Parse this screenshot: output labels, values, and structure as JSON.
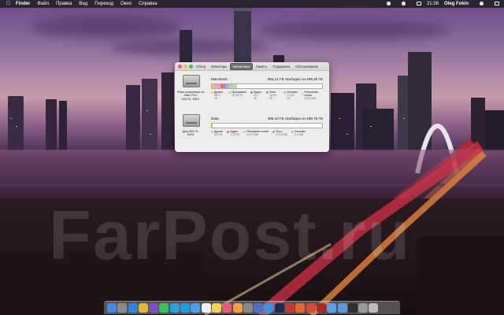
{
  "menubar": {
    "items": [
      "Finder",
      "Файл",
      "Правка",
      "Вид",
      "Переход",
      "Окно",
      "Справка"
    ],
    "clock": "21:38",
    "user": "Oleg Fokin"
  },
  "watermark": "FarPost.ru",
  "about_window": {
    "tabs": [
      "Обзор",
      "Мониторы",
      "Хранилище",
      "Память",
      "Поддержка",
      "Обслуживание"
    ],
    "active_tab": "Хранилище",
    "disks": [
      {
        "name": "Macintosh",
        "free": "384,21 ГБ свободно из 499,25 ГБ",
        "caption": [
          "Флэш-хранилище на",
          "базе PCIe",
          "500 ГБ, SATA"
        ],
        "segments": [
          {
            "color": "#f2c84b",
            "percent": 3
          },
          {
            "color": "#f0a6c4",
            "percent": 5
          },
          {
            "color": "#e46a7a",
            "percent": 3
          },
          {
            "color": "#c879d6",
            "percent": 2
          },
          {
            "color": "#7bc6e8",
            "percent": 2
          },
          {
            "color": "#b4d6a0",
            "percent": 8
          }
        ],
        "legend": [
          {
            "label": "Другие",
            "value": "68,71 ГБ",
            "color": "#f2c84b"
          },
          {
            "label": "Программы",
            "value": "22,39 ГБ",
            "color": "#f0a6c4"
          },
          {
            "label": "Аудио",
            "value": "22,7 ГБ",
            "color": "#e46a7a"
          },
          {
            "label": "Фото",
            "value": "18,09 ГБ",
            "color": "#c879d6"
          },
          {
            "label": "Фильмы",
            "value": "17,29 ГБ",
            "color": "#7bc6e8"
          },
          {
            "label": "Резервные копии",
            "value": "479,8 МБ",
            "color": "#b4d6a0"
          }
        ]
      },
      {
        "name": "Data",
        "free": "498,10 ГБ свободно из 499,78 ГБ",
        "caption": [
          "Диск 500 ГБ,",
          "SATA"
        ],
        "segments": [
          {
            "color": "#f2c84b",
            "percent": 1
          }
        ],
        "legend": [
          {
            "label": "Другие",
            "value": "4,6 ГБ",
            "color": "#f2c84b"
          },
          {
            "label": "Аудио",
            "value": "1,74 ГБ",
            "color": "#e46a7a"
          },
          {
            "label": "Резервные копии",
            "value": "474,4 МБ",
            "color": "#b4d6a0"
          },
          {
            "label": "Фото",
            "value": "270,6 МБ",
            "color": "#c879d6"
          },
          {
            "label": "Фильмы",
            "value": "0,0 МБ",
            "color": "#7bc6e8"
          }
        ]
      }
    ]
  },
  "dock": {
    "apps": [
      {
        "icon": "finder-icon",
        "color": "#3a8ee6"
      },
      {
        "icon": "launchpad-icon",
        "color": "#8c8c8c"
      },
      {
        "icon": "safari-icon",
        "color": "#2f86e0"
      },
      {
        "icon": "chrome-icon",
        "color": "#e3b93a"
      },
      {
        "icon": "viber-icon",
        "color": "#7b51bf"
      },
      {
        "icon": "whatsapp-icon",
        "color": "#36c45a"
      },
      {
        "icon": "telegram-icon",
        "color": "#2aa0dc"
      },
      {
        "icon": "skype-icon",
        "color": "#1d9ae6"
      },
      {
        "icon": "mail-icon",
        "color": "#4f9ee8"
      },
      {
        "icon": "calendar-icon",
        "color": "#f2f2f2"
      },
      {
        "icon": "notes-icon",
        "color": "#f2d24f"
      },
      {
        "icon": "itunes-icon",
        "color": "#e9587f"
      },
      {
        "icon": "photos-icon",
        "color": "#f0a040"
      },
      {
        "icon": "system-preferences-icon",
        "color": "#8a8a8a"
      },
      {
        "icon": "vpn-icon",
        "color": "#4a6fd0"
      },
      {
        "icon": "app-store-icon",
        "color": "#3d92e8"
      },
      {
        "icon": "photoshop-icon",
        "color": "#1b2b54"
      },
      {
        "icon": "utility-icon",
        "color": "#c03a3a"
      },
      {
        "icon": "color-app-icon",
        "color": "#e36a2e"
      },
      {
        "icon": "ftp-client-icon",
        "color": "#d94a3a"
      },
      {
        "icon": "filezilla-icon",
        "color": "#b0281f"
      },
      {
        "icon": "folder-icon",
        "color": "#5aa0e6"
      },
      {
        "icon": "downloads-folder-icon",
        "color": "#5d9ad8"
      },
      {
        "icon": "terminal-icon",
        "color": "#2e2e2e"
      },
      {
        "icon": "preview-icon",
        "color": "#9a9a9a"
      },
      {
        "icon": "trash-icon",
        "color": "#bdbdbd"
      }
    ]
  }
}
